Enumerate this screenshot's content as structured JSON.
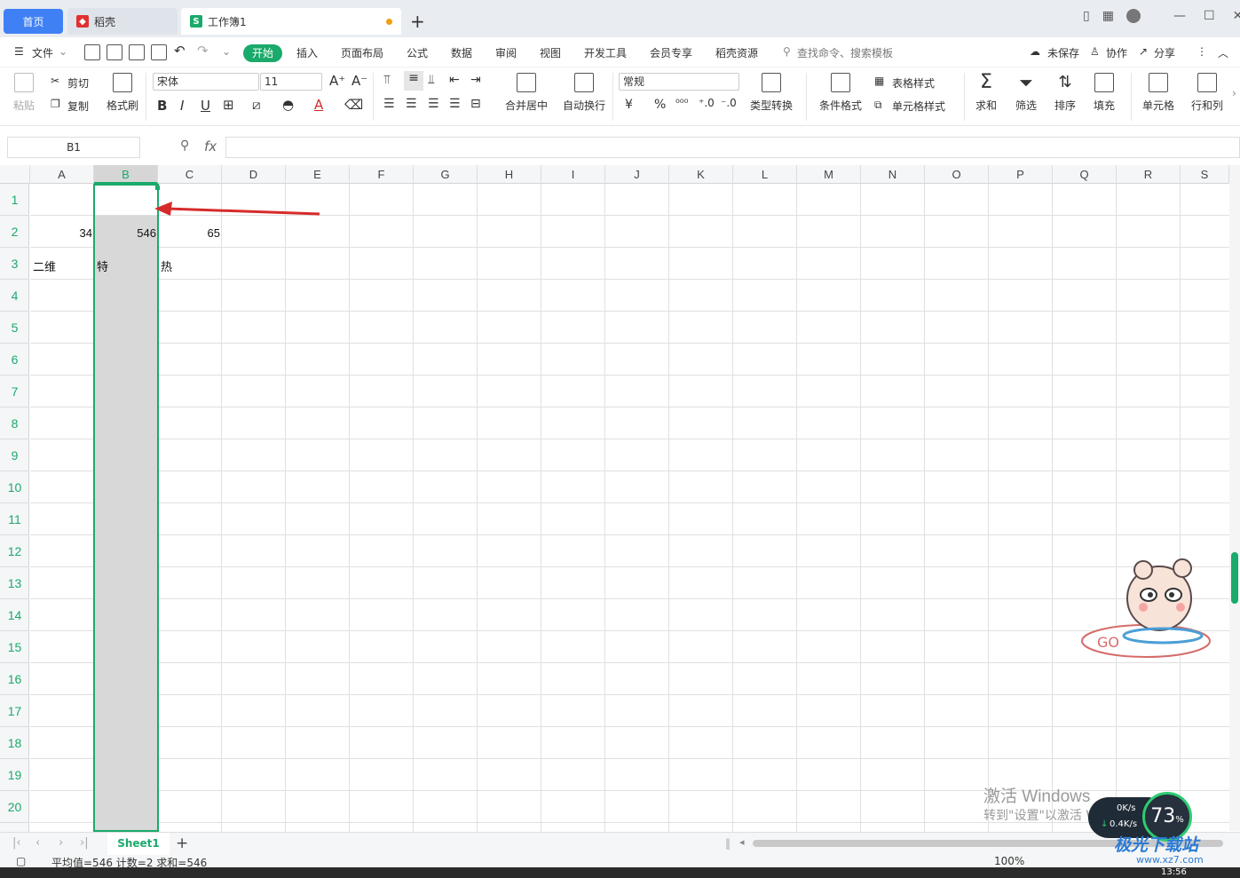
{
  "tabs": {
    "home": "首页",
    "docer": "稻壳",
    "workbook": "工作簿1",
    "new_tab": "+"
  },
  "menu": {
    "file": "文件",
    "start": "开始",
    "items": [
      "插入",
      "页面布局",
      "公式",
      "数据",
      "审阅",
      "视图",
      "开发工具",
      "会员专享",
      "稻壳资源"
    ],
    "search_placeholder": "查找命令、搜索模板",
    "unsaved": "未保存",
    "collab": "协作",
    "share": "分享"
  },
  "ribbon": {
    "paste": "粘贴",
    "cut": "剪切",
    "copy": "复制",
    "format_painter": "格式刷",
    "font_name": "宋体",
    "font_size": "11",
    "merge_center": "合并居中",
    "wrap_text": "自动换行",
    "number_format": "常规",
    "type_convert": "类型转换",
    "cond_format": "条件格式",
    "table_style": "表格样式",
    "cell_style": "单元格样式",
    "sum": "求和",
    "filter": "筛选",
    "sort": "排序",
    "fill": "填充",
    "cell": "单元格",
    "row_col": "行和列",
    "currency_symbol": "¥",
    "percent_symbol": "%"
  },
  "formula_bar": {
    "name_box": "B1",
    "fx": "fx",
    "value": ""
  },
  "grid": {
    "columns": [
      "A",
      "B",
      "C",
      "D",
      "E",
      "F",
      "G",
      "H",
      "I",
      "J",
      "K",
      "L",
      "M",
      "N",
      "O",
      "P",
      "Q",
      "R",
      "S"
    ],
    "rows": [
      "1",
      "2",
      "3",
      "4",
      "5",
      "6",
      "7",
      "8",
      "9",
      "10",
      "11",
      "12",
      "13",
      "14",
      "15",
      "16",
      "17",
      "18",
      "19",
      "20"
    ],
    "cells": {
      "A2": "34",
      "B2": "546",
      "C2": "65",
      "A3": "二维",
      "B3": "特",
      "C3": "热"
    },
    "selected_column": "B"
  },
  "sheets": {
    "active": "Sheet1",
    "add": "+"
  },
  "status": {
    "text": "平均值=546  计数=2  求和=546",
    "zoom": "100%"
  },
  "overlays": {
    "activation_title": "激活 Windows",
    "activation_sub": "转到\"设置\"以激活 Windows。",
    "speed_up": "0K/s",
    "speed_down": "0.4K/s",
    "cpu_percent": "73",
    "site_name": "极光下载站",
    "site_url": "www.xz7.com",
    "time": "13:56"
  },
  "colors": {
    "accent": "#1aaa6b",
    "tab_blue": "#3f80f5",
    "arrow_red": "#d62b2b"
  }
}
